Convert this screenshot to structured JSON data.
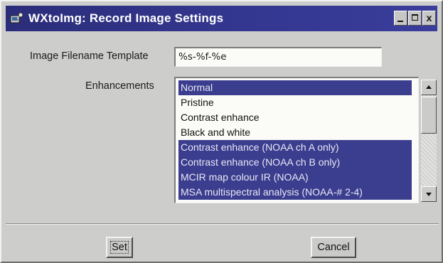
{
  "window": {
    "title": "WXtoImg: Record Image Settings",
    "app_icon": "wxtoimg-app-icon",
    "caption_buttons": [
      "minimize-icon",
      "maximize-icon",
      "close-icon"
    ],
    "close_glyph": "x"
  },
  "form": {
    "filename_label": "Image Filename Template",
    "filename_value": "%s-%f-%e",
    "enhancements_label": "Enhancements",
    "enhancements": [
      {
        "label": "Normal",
        "selected": true
      },
      {
        "label": "Pristine",
        "selected": false
      },
      {
        "label": "Contrast enhance",
        "selected": false
      },
      {
        "label": "Black and white",
        "selected": false
      },
      {
        "label": "Contrast enhance (NOAA ch A only)",
        "selected": true
      },
      {
        "label": "Contrast enhance (NOAA ch B only)",
        "selected": true
      },
      {
        "label": "MCIR map colour IR (NOAA)",
        "selected": true
      },
      {
        "label": "MSA multispectral analysis (NOAA-# 2-4)",
        "selected": true
      }
    ]
  },
  "buttons": {
    "set_label": "Set",
    "cancel_label": "Cancel"
  },
  "colors": {
    "titlebar": "#2b2d7a",
    "selection": "#3b3d8f",
    "dialog_bg": "#cdcdcb"
  }
}
